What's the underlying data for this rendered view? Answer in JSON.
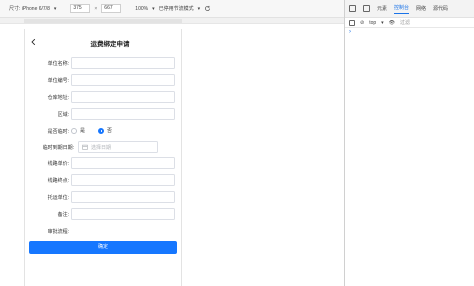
{
  "device_toolbar": {
    "dimension_label": "尺寸: iPhone 6/7/8",
    "width": "375",
    "times": "×",
    "height": "667",
    "zoom": "100%",
    "throttle": "已停用节流模式"
  },
  "devtools": {
    "tabs": [
      "元素",
      "控制台",
      "网络",
      "源代码"
    ],
    "active_tab": "控制台",
    "context": "top",
    "filter_placeholder": "过滤",
    "prompt": "›"
  },
  "form": {
    "back_icon": "chevron-left-icon",
    "title": "运费绑定申请",
    "fields": {
      "unit_name": "单位名称:",
      "unit_code": "单位编号:",
      "warehouse": "仓库地址:",
      "region": "区域:",
      "temporary": "是否临时:",
      "radio_no": "是",
      "radio_yes": "否",
      "temp_date": "临时到期日期:",
      "date_placeholder": "选择日期",
      "route_unit": "线路单价:",
      "route_end": "线路终点:",
      "consign_unit": "托运单位:",
      "remark": "备注:",
      "process": "审批流程:"
    },
    "submit": "确定"
  },
  "colors": {
    "accent": "#1677ff",
    "devtools_accent": "#1a73e8"
  }
}
